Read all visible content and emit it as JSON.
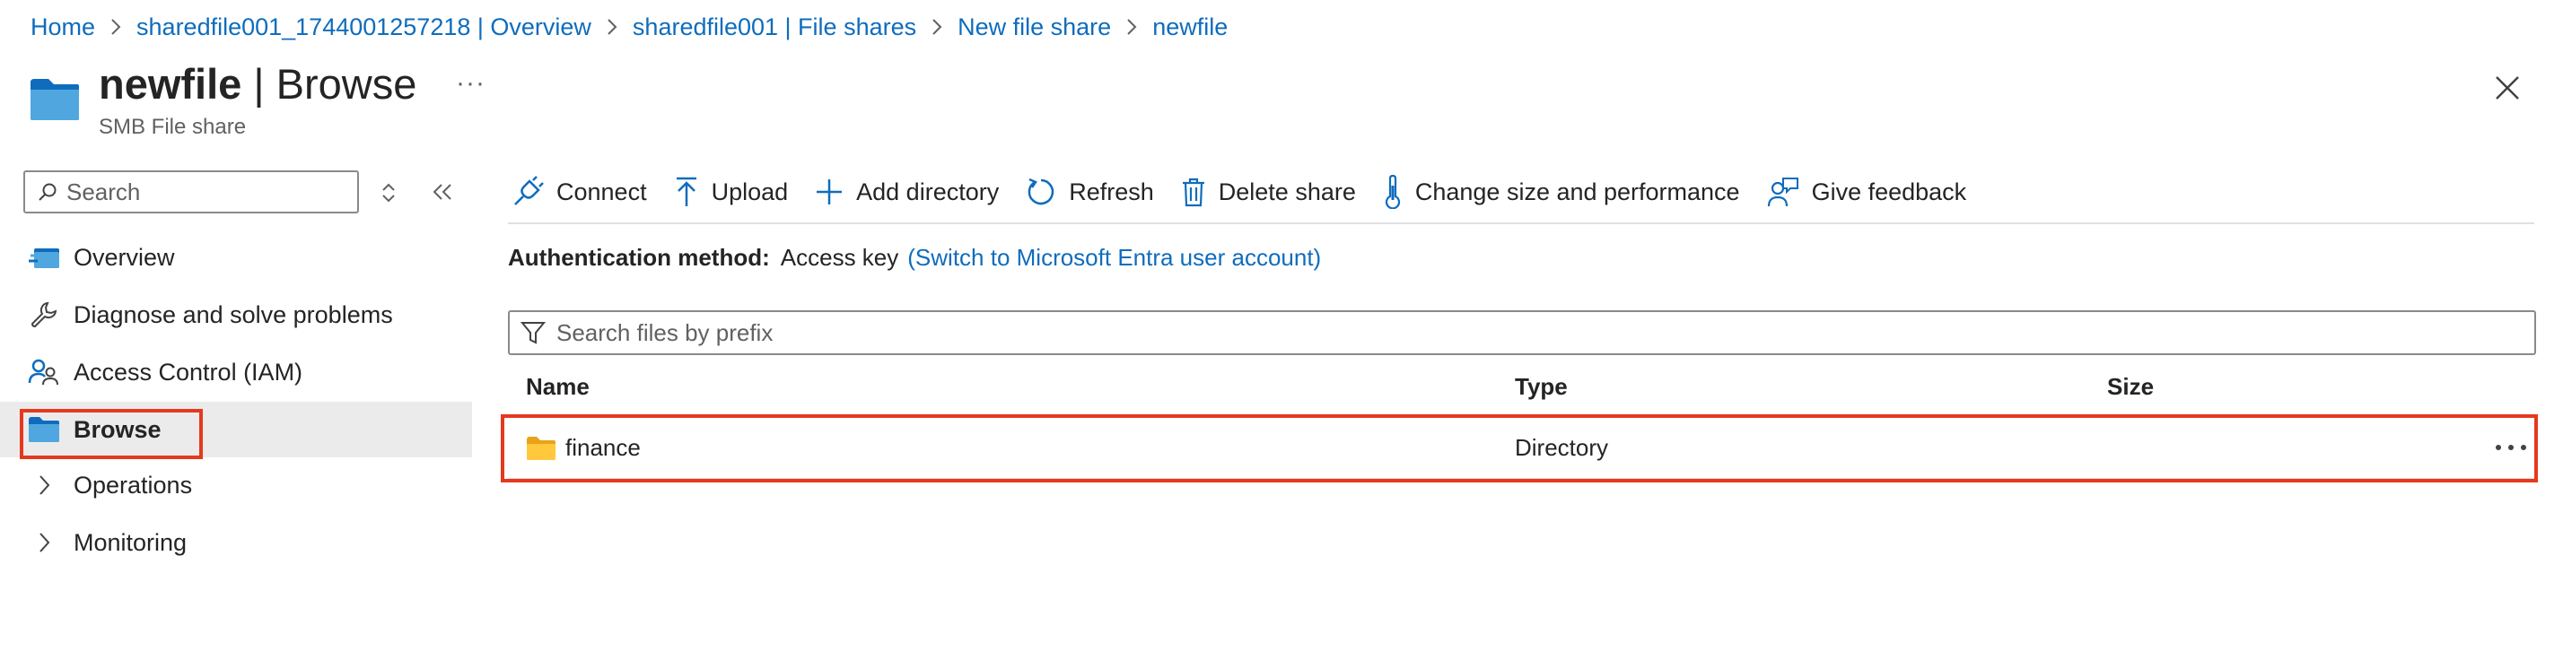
{
  "breadcrumb": [
    "Home",
    "sharedfile001_1744001257218 | Overview",
    "sharedfile001 | File shares",
    "New file share",
    "newfile"
  ],
  "header": {
    "title_bold": "newfile",
    "title_rest": " | Browse",
    "subtitle": "SMB File share",
    "more": "···",
    "icon": "file-share-icon"
  },
  "nav": {
    "search_placeholder": "Search",
    "items": [
      {
        "label": "Overview",
        "icon": "overview-icon"
      },
      {
        "label": "Diagnose and solve problems",
        "icon": "wrench-icon"
      },
      {
        "label": "Access Control (IAM)",
        "icon": "people-icon"
      },
      {
        "label": "Browse",
        "icon": "folder-icon",
        "selected": true
      },
      {
        "label": "Operations",
        "icon": "chevron-right-icon"
      },
      {
        "label": "Monitoring",
        "icon": "chevron-right-icon"
      }
    ]
  },
  "toolbar": {
    "connect": "Connect",
    "upload": "Upload",
    "add_directory": "Add directory",
    "refresh": "Refresh",
    "delete_share": "Delete share",
    "change_size": "Change size and performance",
    "give_feedback": "Give feedback"
  },
  "auth": {
    "label": "Authentication method:",
    "value": "Access key",
    "switch_link": "(Switch to Microsoft Entra user account)"
  },
  "files": {
    "search_placeholder": "Search files by prefix",
    "columns": [
      "Name",
      "Type",
      "Size"
    ],
    "rows": [
      {
        "name": "finance",
        "type": "Directory",
        "size": ""
      }
    ]
  },
  "colors": {
    "accent": "#0f6cbd",
    "highlight": "#e5391e",
    "folder": "#ffc83d"
  }
}
